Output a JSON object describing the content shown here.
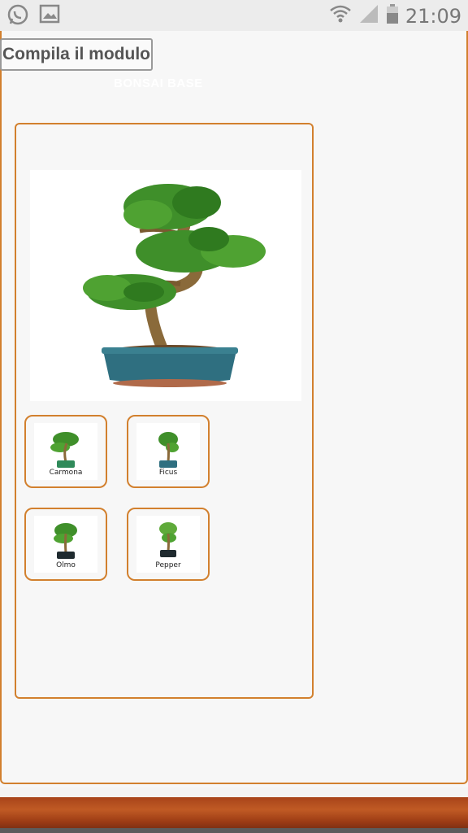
{
  "status_bar": {
    "time": "21:09",
    "icons": [
      "whatsapp-icon",
      "gallery-icon",
      "wifi-icon",
      "signal-icon",
      "battery-icon"
    ]
  },
  "form": {
    "button_label": "Compila il modulo"
  },
  "section": {
    "title": "BONSAI BASE"
  },
  "products": [
    {
      "label": "Carmona"
    },
    {
      "label": "Ficus"
    },
    {
      "label": "Olmo"
    },
    {
      "label": "Pepper"
    }
  ],
  "colors": {
    "accent": "#d2802e",
    "pot_blue": "#2f6f80",
    "leaf_green": "#3f8f2a",
    "trunk": "#8a6a3a"
  }
}
